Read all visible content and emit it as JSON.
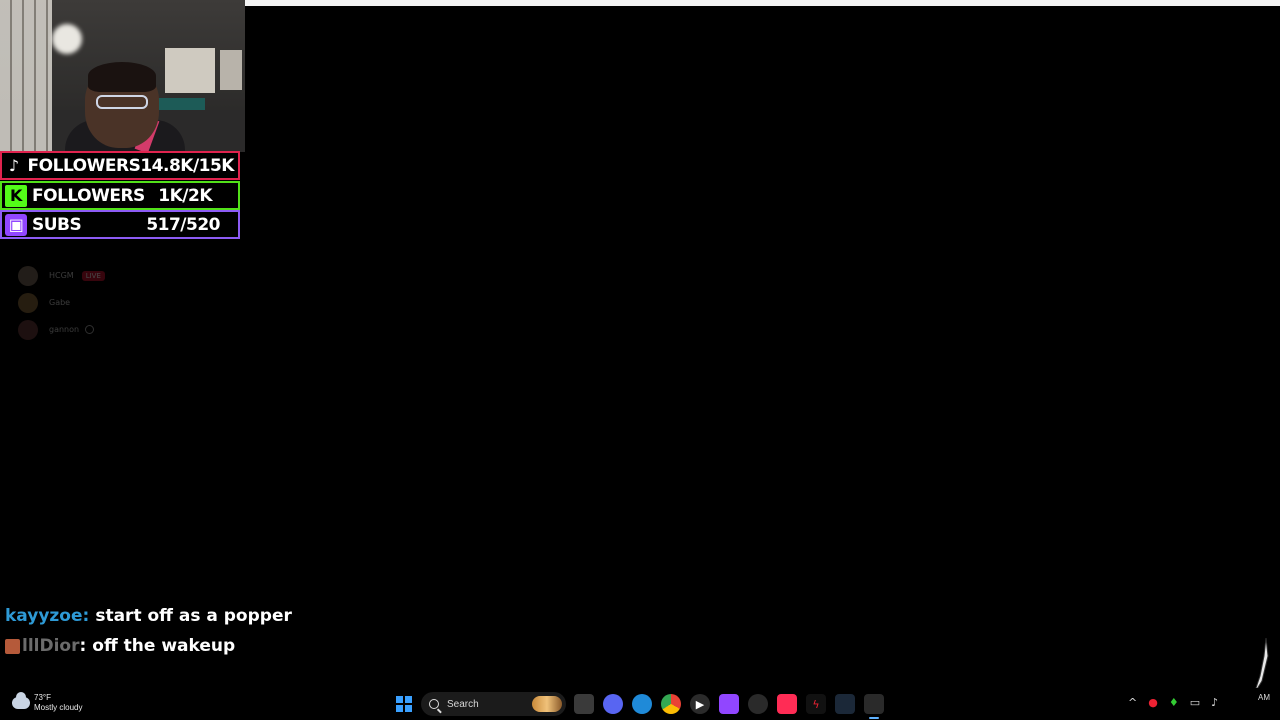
{
  "overlay": {
    "stats": [
      {
        "platform_icon": "tiktok-icon",
        "label": "FOLLOWERS",
        "value": "14.8K/15K",
        "color": "#e0234e"
      },
      {
        "platform_icon": "kick-icon",
        "label": "FOLLOWERS",
        "value": "1K/2K",
        "color": "#52e019"
      },
      {
        "platform_icon": "twitch-icon",
        "label": "SUBS",
        "value": "517/520",
        "color": "#8d5cf5"
      }
    ],
    "friends": [
      {
        "name": "HCGM",
        "status": "LIVE"
      },
      {
        "name": "Gabe"
      },
      {
        "name": "gannon"
      }
    ]
  },
  "chat": [
    {
      "user": "kayyzoe",
      "separator": ":",
      "message": "start off as a popper",
      "user_color": "#2e9ad6"
    },
    {
      "user": "lllDior",
      "separator": ":",
      "message": "off the wakeup",
      "user_color": "#6b6b6b"
    }
  ],
  "taskbar": {
    "weather_temp": "73°F",
    "weather_desc": "Mostly cloudy",
    "search_placeholder": "Search",
    "clock_time": "AM"
  }
}
